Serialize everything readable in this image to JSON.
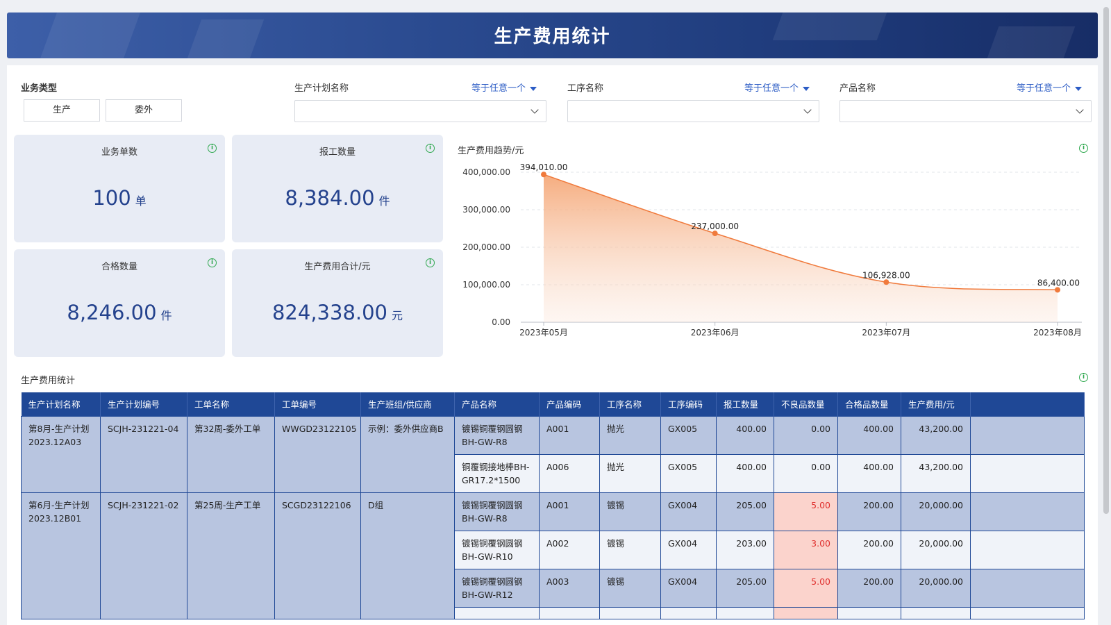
{
  "header": {
    "title": "生产费用统计"
  },
  "filters": {
    "business_type_label": "业务类型",
    "buttons": [
      "生产",
      "委外"
    ],
    "fields": [
      {
        "label": "生产计划名称",
        "operator": "等于任意一个"
      },
      {
        "label": "工序名称",
        "operator": "等于任意一个"
      },
      {
        "label": "产品名称",
        "operator": "等于任意一个"
      }
    ]
  },
  "cards": [
    {
      "title": "业务单数",
      "value": "100",
      "unit": "单"
    },
    {
      "title": "报工数量",
      "value": "8,384.00",
      "unit": "件"
    },
    {
      "title": "合格数量",
      "value": "8,246.00",
      "unit": "件"
    },
    {
      "title": "生产费用合计/元",
      "value": "824,338.00",
      "unit": "元"
    }
  ],
  "chart_data": {
    "type": "area",
    "title": "生产费用趋势/元",
    "categories": [
      "2023年05月",
      "2023年06月",
      "2023年07月",
      "2023年08月"
    ],
    "values": [
      394010,
      237000,
      106928,
      86400
    ],
    "data_labels": [
      "394,010.00",
      "237,000.00",
      "106,928.00",
      "86,400.00"
    ],
    "ylim": [
      0,
      400000
    ],
    "yticks": [
      "0.00",
      "100,000.00",
      "200,000.00",
      "300,000.00",
      "400,000.00"
    ],
    "colors": {
      "line": "#f07a3c",
      "fill_top": "#f5a878"
    }
  },
  "table": {
    "title": "生产费用统计",
    "headers": [
      "生产计划名称",
      "生产计划编号",
      "工单名称",
      "工单编号",
      "生产班组/供应商",
      "产品名称",
      "产品编码",
      "工序名称",
      "工序编码",
      "报工数量",
      "不良品数量",
      "合格品数量",
      "生产费用/元"
    ],
    "groups": [
      {
        "plan": "第8月-生产计划2023.12A03",
        "plan_no": "SCJH-231221-04",
        "order": "第32周-委外工单",
        "order_no": "WWGD23122105",
        "team": "示例：委外供应商B",
        "rows": [
          {
            "product": "镀锡铜覆钢圆钢BH-GW-R8",
            "code": "A001",
            "process": "抛光",
            "pcode": "GX005",
            "qty": "400.00",
            "bad": "0.00",
            "good": "400.00",
            "cost": "43,200.00"
          },
          {
            "product": "铜覆钢接地棒BH-GR17.2*1500",
            "code": "A006",
            "process": "抛光",
            "pcode": "GX005",
            "qty": "400.00",
            "bad": "0.00",
            "good": "400.00",
            "cost": "43,200.00"
          }
        ]
      },
      {
        "plan": "第6月-生产计划2023.12B01",
        "plan_no": "SCJH-231221-02",
        "order": "第25周-生产工单",
        "order_no": "SCGD23122106",
        "team": "D组",
        "rows": [
          {
            "product": "镀锡铜覆钢圆钢BH-GW-R8",
            "code": "A001",
            "process": "镀锡",
            "pcode": "GX004",
            "qty": "205.00",
            "bad": "5.00",
            "good": "200.00",
            "cost": "20,000.00"
          },
          {
            "product": "镀锡铜覆钢圆钢BH-GW-R10",
            "code": "A002",
            "process": "镀锡",
            "pcode": "GX004",
            "qty": "203.00",
            "bad": "3.00",
            "good": "200.00",
            "cost": "20,000.00"
          },
          {
            "product": "镀锡铜覆钢圆钢BH-GW-R12",
            "code": "A003",
            "process": "镀锡",
            "pcode": "GX004",
            "qty": "205.00",
            "bad": "5.00",
            "good": "200.00",
            "cost": "20,000.00"
          }
        ]
      }
    ]
  }
}
